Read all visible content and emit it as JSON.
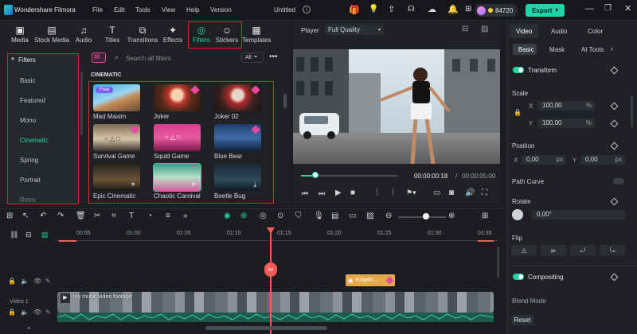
{
  "app": {
    "name": "Wondershare Filmora",
    "menu": [
      "File",
      "Edit",
      "Tools",
      "View",
      "Help",
      "Version"
    ],
    "project_title": "Untitled",
    "credits": "84720",
    "export_label": "Export"
  },
  "media_tabs": [
    "Media",
    "Stock Media",
    "Audio",
    "Titles",
    "Transitions",
    "Effects",
    "Filters",
    "Stickers",
    "Templates"
  ],
  "filters_panel": {
    "header": "Filters",
    "categories": [
      "Basic",
      "Featured",
      "Mono",
      "Cinematic",
      "Spring",
      "Portrait",
      "Retro"
    ],
    "active_category": "Cinematic",
    "search_placeholder": "Search all filters",
    "filter_scope": "All",
    "section_title": "CINEMATIC",
    "items": [
      {
        "name": "Mad Maxim",
        "badge": "Free"
      },
      {
        "name": "Joker",
        "badge": ""
      },
      {
        "name": "Joker 02",
        "badge": ""
      },
      {
        "name": "Survival Game",
        "badge": ""
      },
      {
        "name": "Squid Game",
        "badge": ""
      },
      {
        "name": "Blue Bear",
        "badge": ""
      },
      {
        "name": "Epic Cinematic",
        "badge": ""
      },
      {
        "name": "Chaotic Carnival",
        "badge": ""
      },
      {
        "name": "Beetle Bug",
        "badge": ""
      }
    ]
  },
  "player": {
    "label": "Player",
    "quality": "Full Quality",
    "current_time": "00:00:00:18",
    "separator": "/",
    "total_time": "00:00:05:00",
    "progress": 0.15
  },
  "inspector": {
    "tabs": [
      "Video",
      "Audio",
      "Color"
    ],
    "subtabs": [
      "Basic",
      "Mask",
      "AI Tools"
    ],
    "transform_title": "Transform",
    "scale_label": "Scale",
    "scale_x_label": "X",
    "scale_x": "100,00",
    "scale_y_label": "Y",
    "scale_y": "100,00",
    "scale_unit": "%",
    "position_label": "Position",
    "pos_x_label": "X",
    "pos_x": "0,00",
    "pos_y_label": "Y",
    "pos_y": "0,00",
    "pos_unit": "px",
    "path_curve_label": "Path Curve",
    "rotate_label": "Rotate",
    "rotate_value": "0,00°",
    "flip_label": "Flip",
    "compositing_title": "Compositing",
    "blend_mode_label": "Blend Mode",
    "reset_label": "Reset"
  },
  "timeline": {
    "ruler": [
      "00:55",
      "01:00",
      "01:05",
      "01:10",
      "01:15",
      "01:20",
      "01:25",
      "01:30",
      "01:35"
    ],
    "track_label": "Video 1",
    "clip_name": "my music video footage",
    "effect_clip": "Rotatin..."
  },
  "colors": {
    "accent": "#21d3a8",
    "highlight_red": "#d9262f",
    "playhead": "#ff5b5b",
    "effect_clip": "#e2a84b"
  }
}
